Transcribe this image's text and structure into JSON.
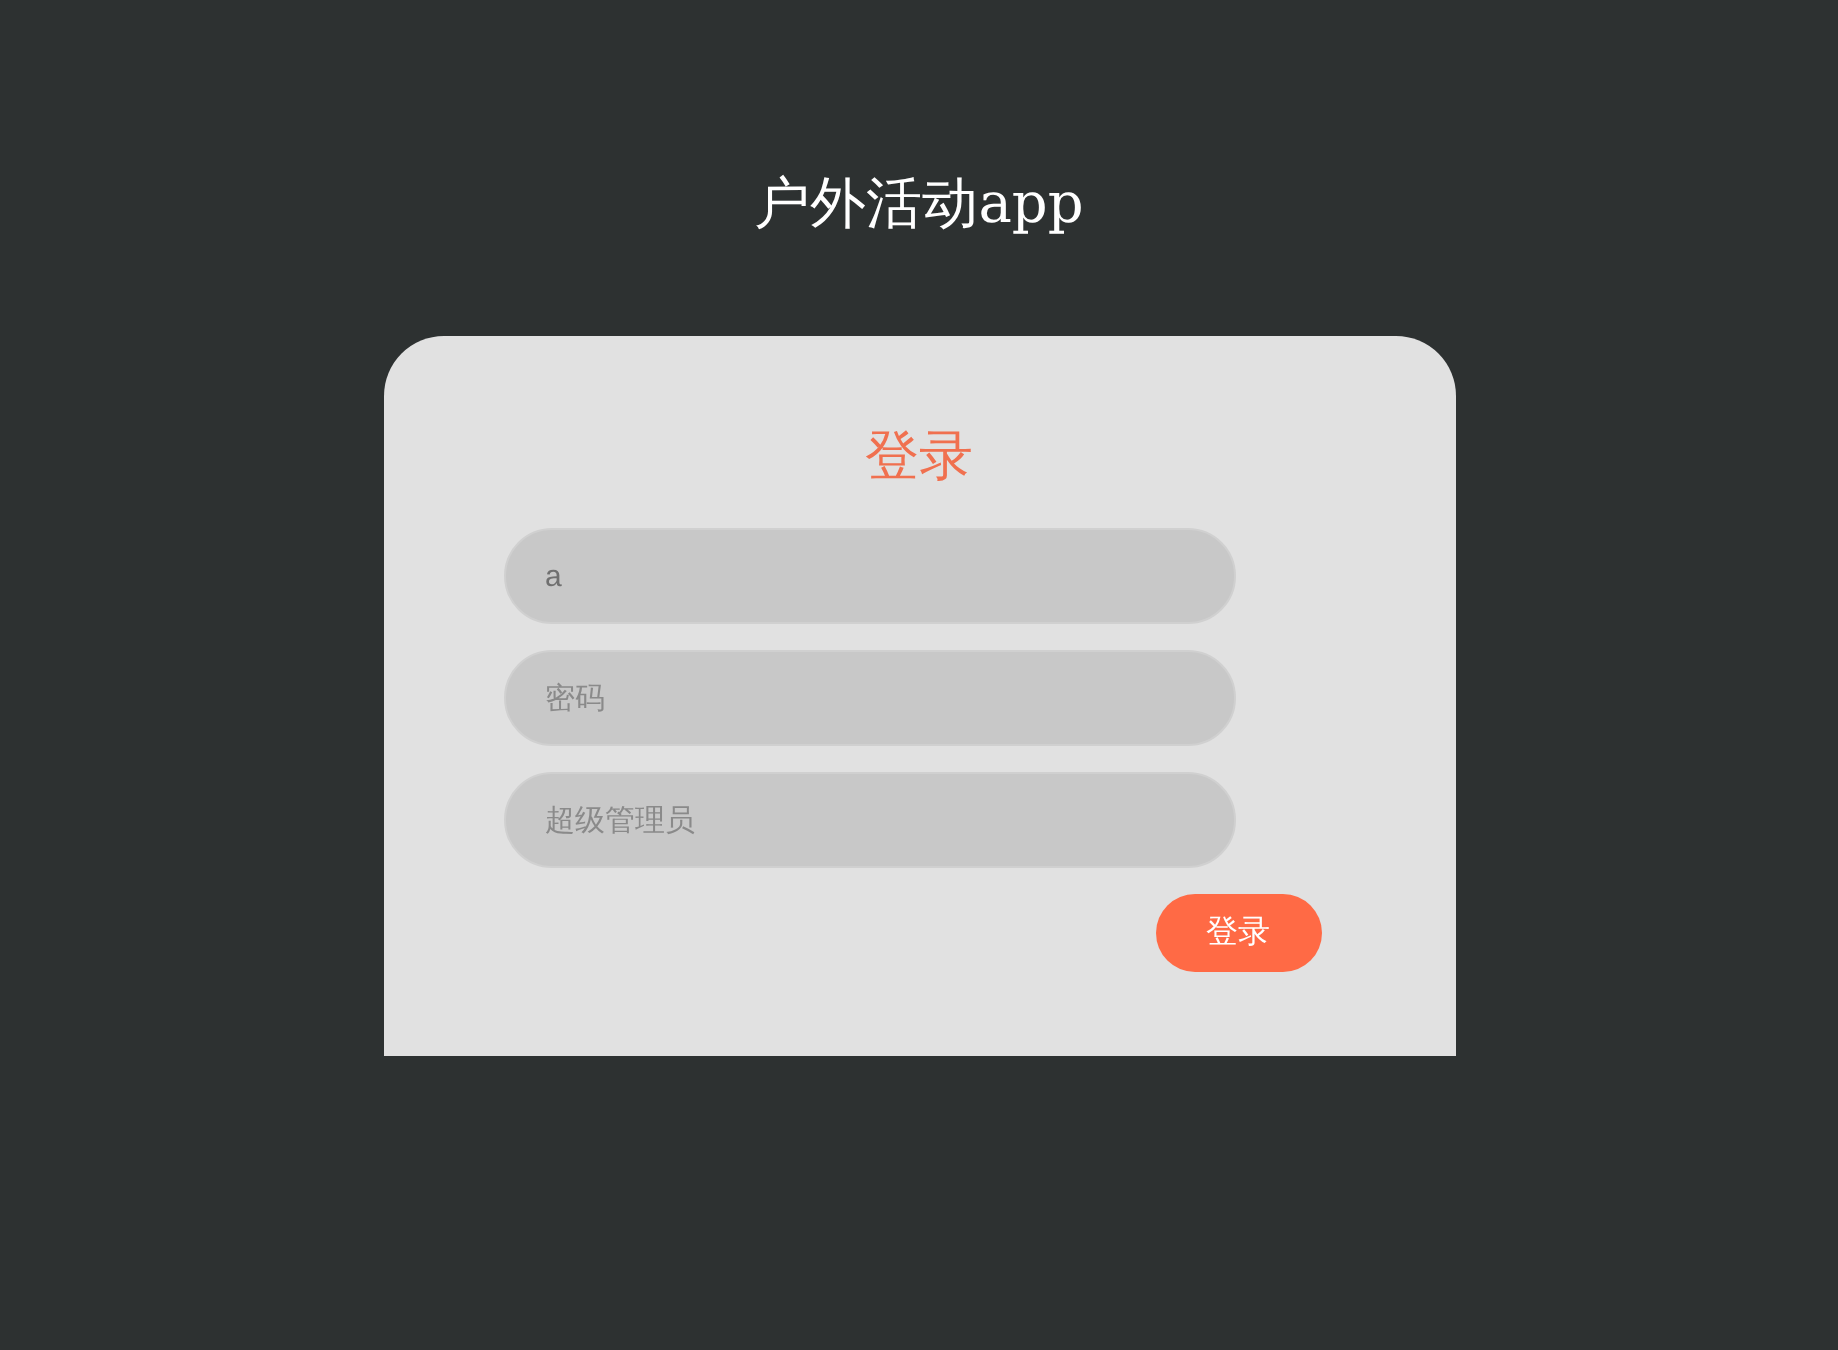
{
  "app_title": "户外活动app",
  "login_card": {
    "heading": "登录",
    "fields": [
      {
        "kind": "text",
        "value": "a"
      },
      {
        "kind": "password",
        "placeholder": "密码"
      },
      {
        "kind": "text",
        "placeholder": "超级管理员"
      }
    ],
    "submit_button": "登录"
  }
}
